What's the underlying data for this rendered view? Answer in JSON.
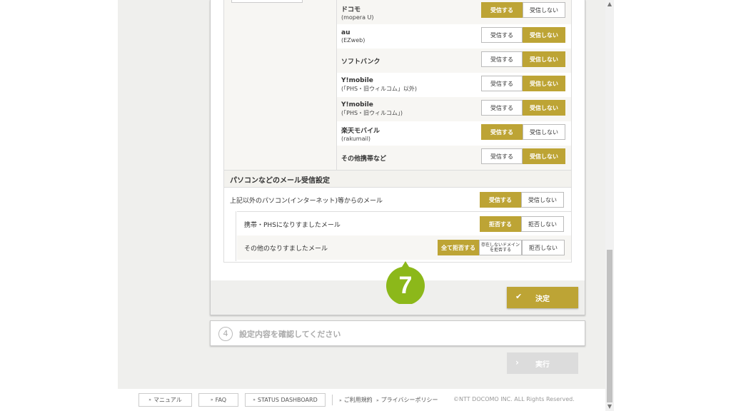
{
  "opt_receive": "受信する",
  "opt_no_receive": "受信しない",
  "carriers": [
    {
      "name": "ドコモ",
      "sub": "(mopera U)",
      "state": "receive"
    },
    {
      "name": "au",
      "sub": "(EZweb)",
      "state": "no"
    },
    {
      "name": "ソフトバンク",
      "sub": "",
      "state": "no"
    },
    {
      "name": "Y!mobile",
      "sub": "(「PHS・旧ウィルコム」以外)",
      "state": "no"
    },
    {
      "name": "Y!mobile",
      "sub": "(「PHS・旧ウィルコム」)",
      "state": "no"
    },
    {
      "name": "楽天モバイル",
      "sub": "(rakumail)",
      "state": "receive"
    },
    {
      "name": "その他携帯など",
      "sub": "",
      "state": "no"
    }
  ],
  "pc_section": {
    "title": "パソコンなどのメール受信設定",
    "pc_mail_label": "上記以外のパソコン(インターネット)等からのメール",
    "spoof_mobile_label": "携帯・PHSになりすましたメール",
    "spoof_mobile_reject": "拒否する",
    "spoof_mobile_no_reject": "拒否しない",
    "spoof_other_label": "その他のなりすましたメール",
    "spoof_other_all": "全て拒否する",
    "spoof_other_domain_1": "存在しないドメイン",
    "spoof_other_domain_2": "を拒否する",
    "spoof_other_no": "拒否しない"
  },
  "step_badge": "7",
  "decide_label": "決定",
  "step4": {
    "num": "4",
    "text": "設定内容を確認してください"
  },
  "exec_label": "実行",
  "footer": {
    "manual": "マニュアル",
    "faq": "FAQ",
    "status": "STATUS DASHBOARD",
    "terms": "ご利用規約",
    "privacy": "プライバシーポリシー",
    "copyright": "©NTT DOCOMO INC. ALL Rights Reserved."
  },
  "colors": {
    "accent": "#bda435",
    "badge": "#8cb81a"
  }
}
